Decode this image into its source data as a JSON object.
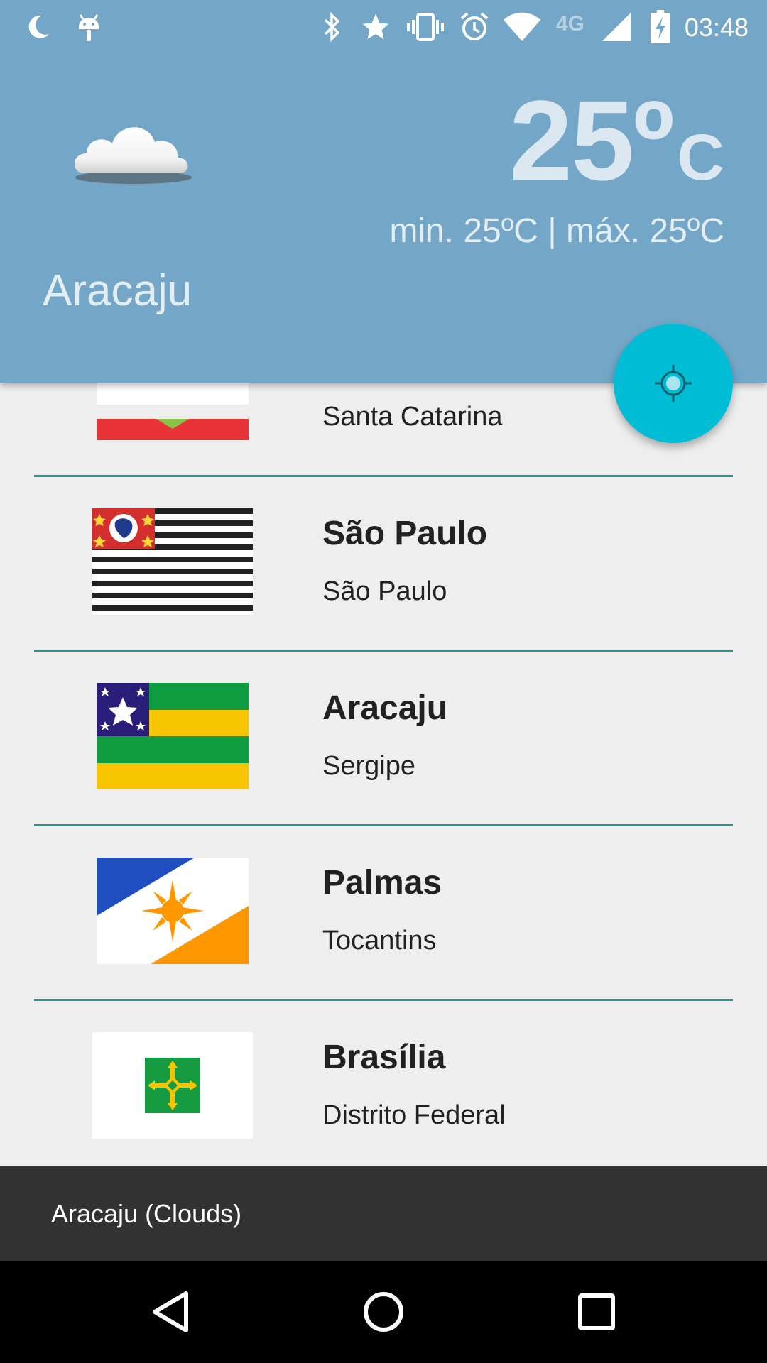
{
  "status_bar": {
    "time": "03:48",
    "network_label": "4G",
    "icons": [
      "moon-icon",
      "android-icon",
      "bluetooth-icon",
      "star-icon",
      "vibrate-icon",
      "alarm-icon",
      "wifi-icon",
      "signal-icon",
      "battery-charging-icon"
    ]
  },
  "weather": {
    "condition_icon": "cloud-icon",
    "temperature": "25º",
    "unit": "C",
    "min_max": "min. 25ºC | máx. 25ºC",
    "city": "Aracaju"
  },
  "fab": {
    "icon": "my-location-icon"
  },
  "cities": [
    {
      "name": "",
      "state": "Santa Catarina",
      "flag": "santa-catarina-flag"
    },
    {
      "name": "São Paulo",
      "state": "São Paulo",
      "flag": "sao-paulo-flag"
    },
    {
      "name": "Aracaju",
      "state": "Sergipe",
      "flag": "sergipe-flag"
    },
    {
      "name": "Palmas",
      "state": "Tocantins",
      "flag": "tocantins-flag"
    },
    {
      "name": "Brasília",
      "state": "Distrito Federal",
      "flag": "distrito-federal-flag"
    }
  ],
  "snackbar": {
    "text": "Aracaju (Clouds)"
  },
  "nav": {
    "back": "back-icon",
    "home": "home-icon",
    "recents": "recents-icon"
  },
  "colors": {
    "header": "#74a7c7",
    "fab": "#00bcd4",
    "divider": "#2c948f",
    "snackbar": "#323232"
  }
}
